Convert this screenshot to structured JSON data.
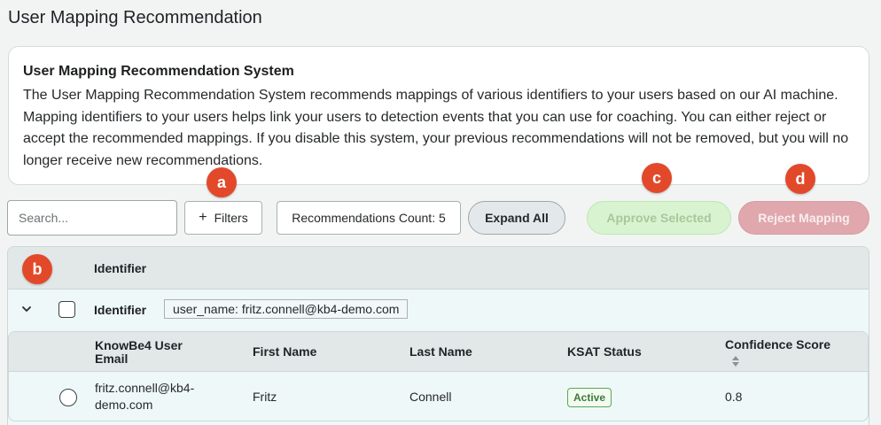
{
  "page": {
    "title": "User Mapping Recommendation"
  },
  "info": {
    "heading": "User Mapping Recommendation System",
    "body": "The User Mapping Recommendation System recommends mappings of various identifiers to your users based on our AI machine. Mapping identifiers to your users helps link your users to detection events that you can use for coaching. You can either reject or accept the recommended mappings. If you disable this system, your previous recommendations will not be removed, but you will no longer receive new recommendations."
  },
  "badges": {
    "a": "a",
    "b": "b",
    "c": "c",
    "d": "d"
  },
  "toolbar": {
    "search_placeholder": "Search...",
    "filters_label": "Filters",
    "filters_icon": "+",
    "count_label": "Recommendations Count: 5",
    "expand_label": "Expand All",
    "approve_label": "Approve Selected",
    "reject_label": "Reject Mapping"
  },
  "table": {
    "header": "Identifier",
    "group": {
      "label": "Identifier",
      "value": "user_name: fritz.connell@kb4-demo.com"
    },
    "columns": {
      "email": "KnowBe4 User Email",
      "first_name": "First Name",
      "last_name": "Last Name",
      "ksat": "KSAT Status",
      "confidence": "Confidence Score"
    },
    "rows": [
      {
        "email": "fritz.connell@kb4-demo.com",
        "first_name": "Fritz",
        "last_name": "Connell",
        "ksat": "Active",
        "confidence": "0.8"
      }
    ]
  },
  "colors": {
    "badge": "#e2492a",
    "approve_bg": "#d8f3cf",
    "reject_bg": "#e0a7ad",
    "active_status": "#5aa65a"
  }
}
